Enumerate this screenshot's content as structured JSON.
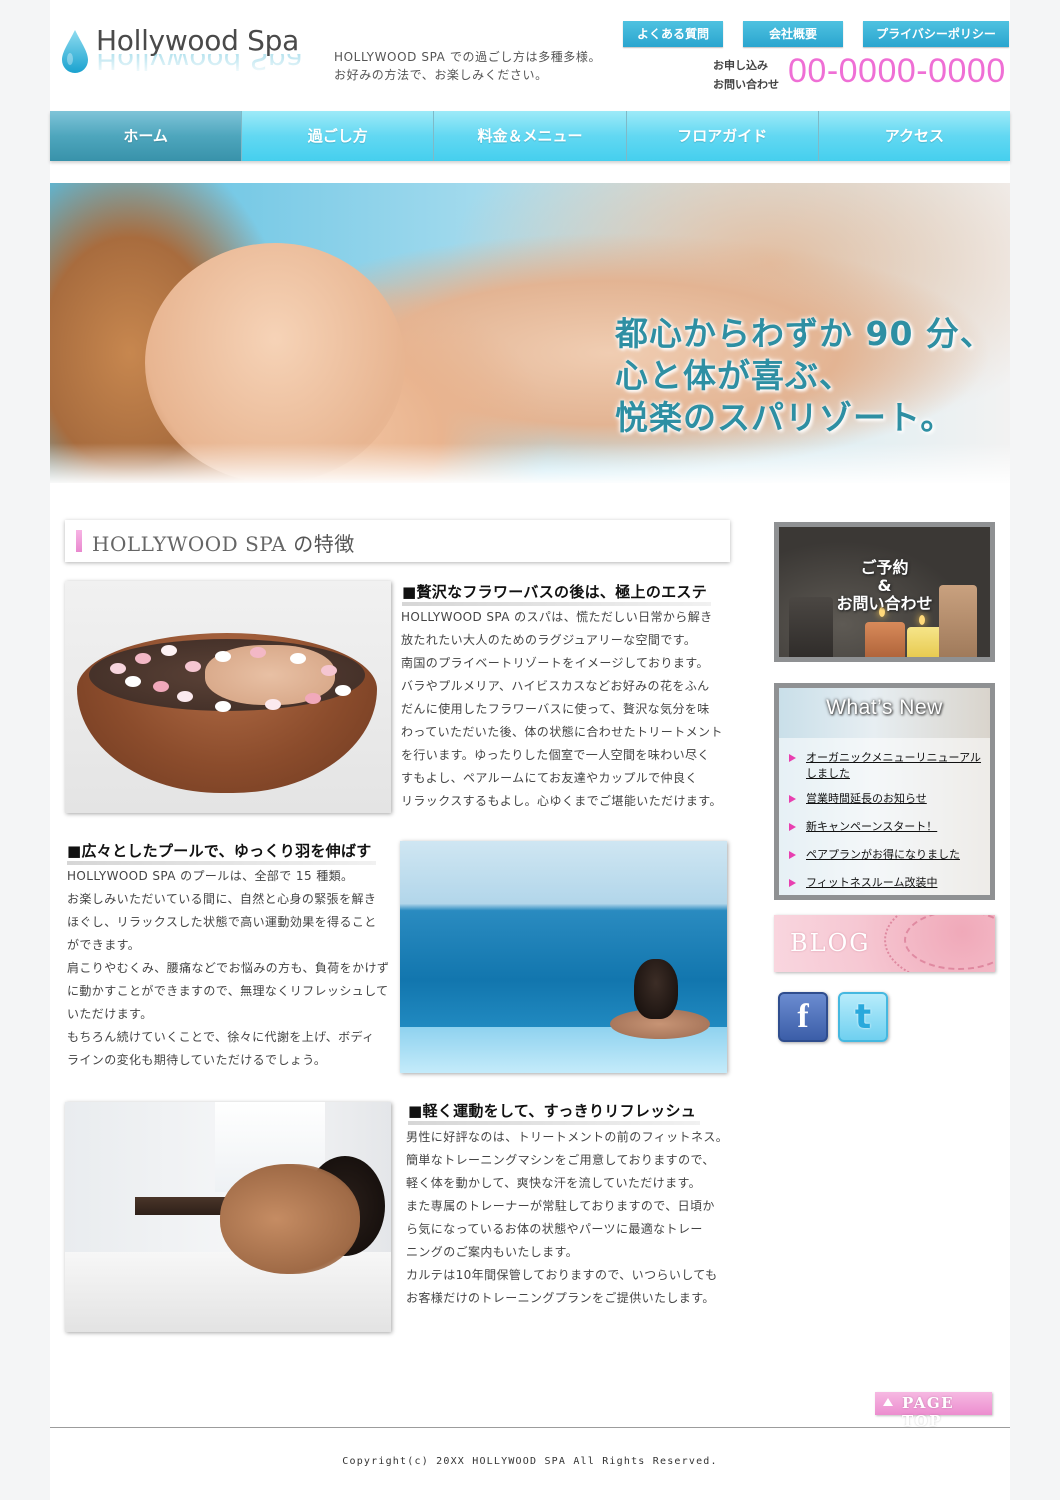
{
  "header": {
    "logo_text": "Hollywood Spa",
    "tagline_line1": "HOLLYWOOD SPA での過ごし方は多種多様。",
    "tagline_line2": "お好みの方法で、お楽しみください。",
    "top_links": [
      "よくある質問",
      "会社概要",
      "プライバシーポリシー"
    ],
    "contact_label1": "お申し込み",
    "contact_label2": "お問い合わせ",
    "phone": "00-0000-0000"
  },
  "nav": {
    "items": [
      "ホーム",
      "過ごし方",
      "料金＆メニュー",
      "フロアガイド",
      "アクセス"
    ],
    "active": "ホーム"
  },
  "hero": {
    "line1": "都心からわずか 90 分、",
    "line2": "心と体が喜ぶ、",
    "line3": "悦楽のスパリゾート。"
  },
  "features": {
    "title_prefix": "HOLLYWOOD SPA",
    "title_suffix": "の特徴",
    "items": [
      {
        "heading": "■贅沢なフラワーバスの後は、極上のエステ",
        "lines": [
          "HOLLYWOOD SPA のスパは、慌ただしい日常から解き",
          "放たれたい大人のためのラグジュアリーな空間です。",
          "南国のプライベートリゾートをイメージしております。",
          "バラやプルメリア、ハイビスカスなどお好みの花をふん",
          "だんに使用したフラワーバスに使って、贅沢な気分を味",
          "わっていただいた後、体の状態に合わせたトリートメント",
          "を行います。ゆったりした個室で一人空間を味わい尽く",
          "すもよし、ペアルームにてお友達やカップルで仲良く",
          "リラックスするもよし。心ゆくまでご堪能いただけます。"
        ]
      },
      {
        "heading": "■広々としたプールで、ゆっくり羽を伸ばす",
        "lines": [
          "HOLLYWOOD SPA のプールは、全部で 15 種類。",
          "お楽しみいただいている間に、自然と心身の緊張を解き",
          "ほぐし、リラックスした状態で高い運動効果を得ること",
          "ができます。",
          "肩こりやむくみ、腰痛などでお悩みの方も、負荷をかけず",
          "に動かすことができますので、無理なくリフレッシュして",
          "いただけます。",
          "もちろん続けていくことで、徐々に代謝を上げ、ボディ",
          "ラインの変化も期待していただけるでしょう。"
        ]
      },
      {
        "heading": "■軽く運動をして、すっきりリフレッシュ",
        "lines": [
          "男性に好評なのは、トリートメントの前のフィットネス。",
          "簡単なトレーニングマシンをご用意しておりますので、",
          "軽く体を動かして、爽快な汗を流していただけます。",
          "また専属のトレーナーが常駐しておりますので、日頃か",
          "ら気になっているお体の状態やパーツに最適なトレー",
          "ニングのご案内もいたします。",
          "カルテは10年間保管しておりますので、いつらいしても",
          "お客様だけのトレーニングプランをご提供いたします。"
        ]
      }
    ]
  },
  "sidebar": {
    "reserve_line1": "ご予約",
    "reserve_line2": "&",
    "reserve_line3": "お問い合わせ",
    "news_title": "What’s New",
    "news_items": [
      "オーガニックメニューリニューアル",
      "しました",
      "営業時間延長のお知らせ",
      "新キャンペーンスタート！",
      "ペアプランがお得になりました",
      "フィットネスルーム改装中"
    ],
    "blog_label": "BLOG",
    "facebook_glyph": "f",
    "twitter_glyph": "t"
  },
  "footer": {
    "page_top": "PAGE TOP",
    "copyright": "Copyright(c) 20XX HOLLYWOOD SPA All Rights Reserved."
  },
  "colors": {
    "accent_cyan": "#45cfee",
    "nav_active": "#4ea6bd",
    "phone_pink": "#ef6fd5",
    "title_pink": "#e988cf",
    "link_button": "#2aa5cf"
  }
}
